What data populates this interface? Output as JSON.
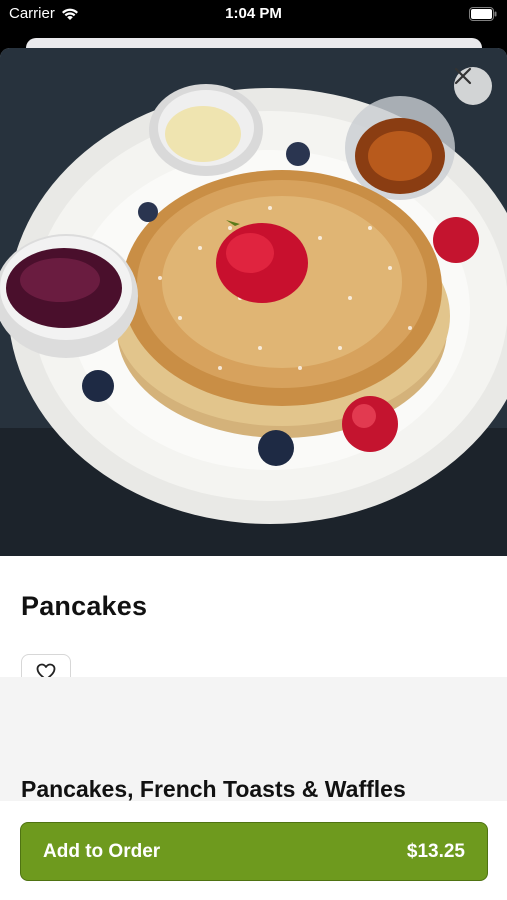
{
  "status_bar": {
    "carrier": "Carrier",
    "time": "1:04 PM"
  },
  "item": {
    "title": "Pancakes",
    "image_description_icon": "pancakes-photo"
  },
  "favorite": {
    "icon": "heart-icon"
  },
  "section": {
    "title": "Pancakes, French Toasts & Waffles"
  },
  "order_button": {
    "label": "Add to Order",
    "price": "$13.25"
  },
  "colors": {
    "accent": "#6e9a1e",
    "accent_border": "#4f7312",
    "section_bg": "#f4f4f4"
  }
}
